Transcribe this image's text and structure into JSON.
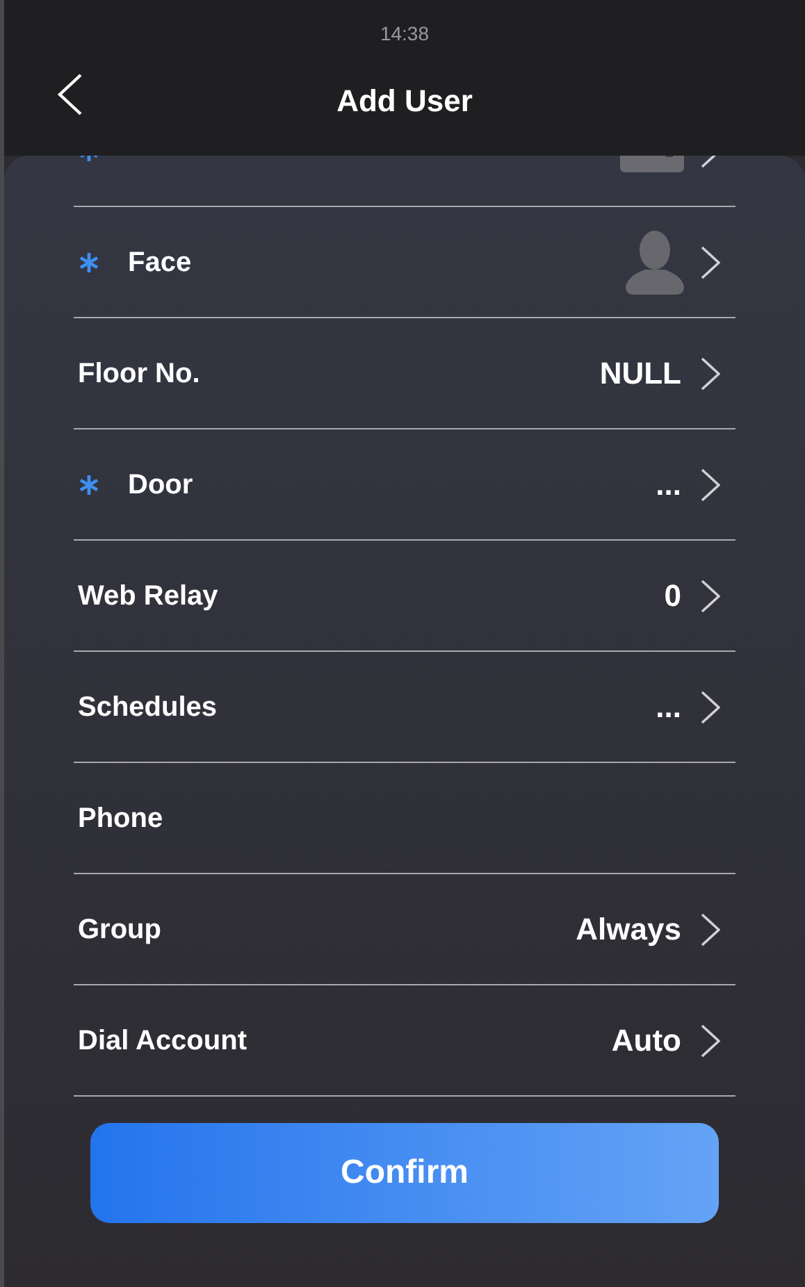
{
  "status_bar": {
    "time": "14:38"
  },
  "header": {
    "title": "Add User"
  },
  "rows": [
    {
      "kind": "card",
      "required": true,
      "chevron": true
    },
    {
      "label": "Face",
      "kind": "person",
      "required": true,
      "chevron": true
    },
    {
      "label": "Floor No.",
      "required": false,
      "value": "NULL",
      "chevron": true
    },
    {
      "label": "Door",
      "required": true,
      "value": "...",
      "chevron": true
    },
    {
      "label": "Web Relay",
      "required": false,
      "value": "0",
      "chevron": true
    },
    {
      "label": "Schedules",
      "required": false,
      "value": "...",
      "chevron": true
    },
    {
      "label": "Phone",
      "required": false,
      "chevron": false
    },
    {
      "label": "Group",
      "required": false,
      "value": "Always",
      "chevron": true
    },
    {
      "label": "Dial Account",
      "required": false,
      "value": "Auto",
      "chevron": true
    }
  ],
  "confirm_button": {
    "label": "Confirm"
  }
}
